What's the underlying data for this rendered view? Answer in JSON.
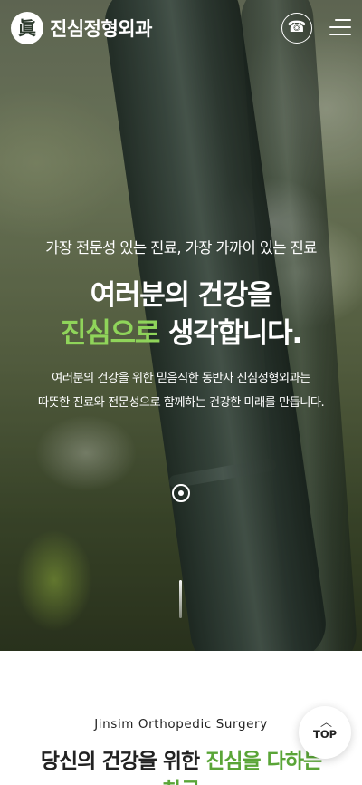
{
  "header": {
    "logo_glyph": "眞",
    "logo_text": "진심정형외과",
    "phone_icon": "☎",
    "menu_icon": "hamburger-menu"
  },
  "hero": {
    "subtitle": "가장 전문성 있는 진료, 가장 가까이 있는 진료",
    "title_line1": "여러분의 건강을",
    "title_line2_green": "진심으로",
    "title_line2_rest": " 생각합니다.",
    "desc_line1": "여러분의 건강을 위한 믿음직한 동반자 진심정형외과는",
    "desc_line2": "따뜻한 진료와 전문성으로 함께하는 건강한 미래를 만듭니다.",
    "accent_color": "#8fd45a"
  },
  "section": {
    "eyebrow": "Jinsim Orthopedic Surgery",
    "title_plain": "당신의 건강을 위한 ",
    "title_green": "진심을 다하는",
    "title_line2": "치료",
    "accent_color": "#5aa537"
  },
  "top_button": {
    "arrow": "︿",
    "label": "TOP"
  }
}
